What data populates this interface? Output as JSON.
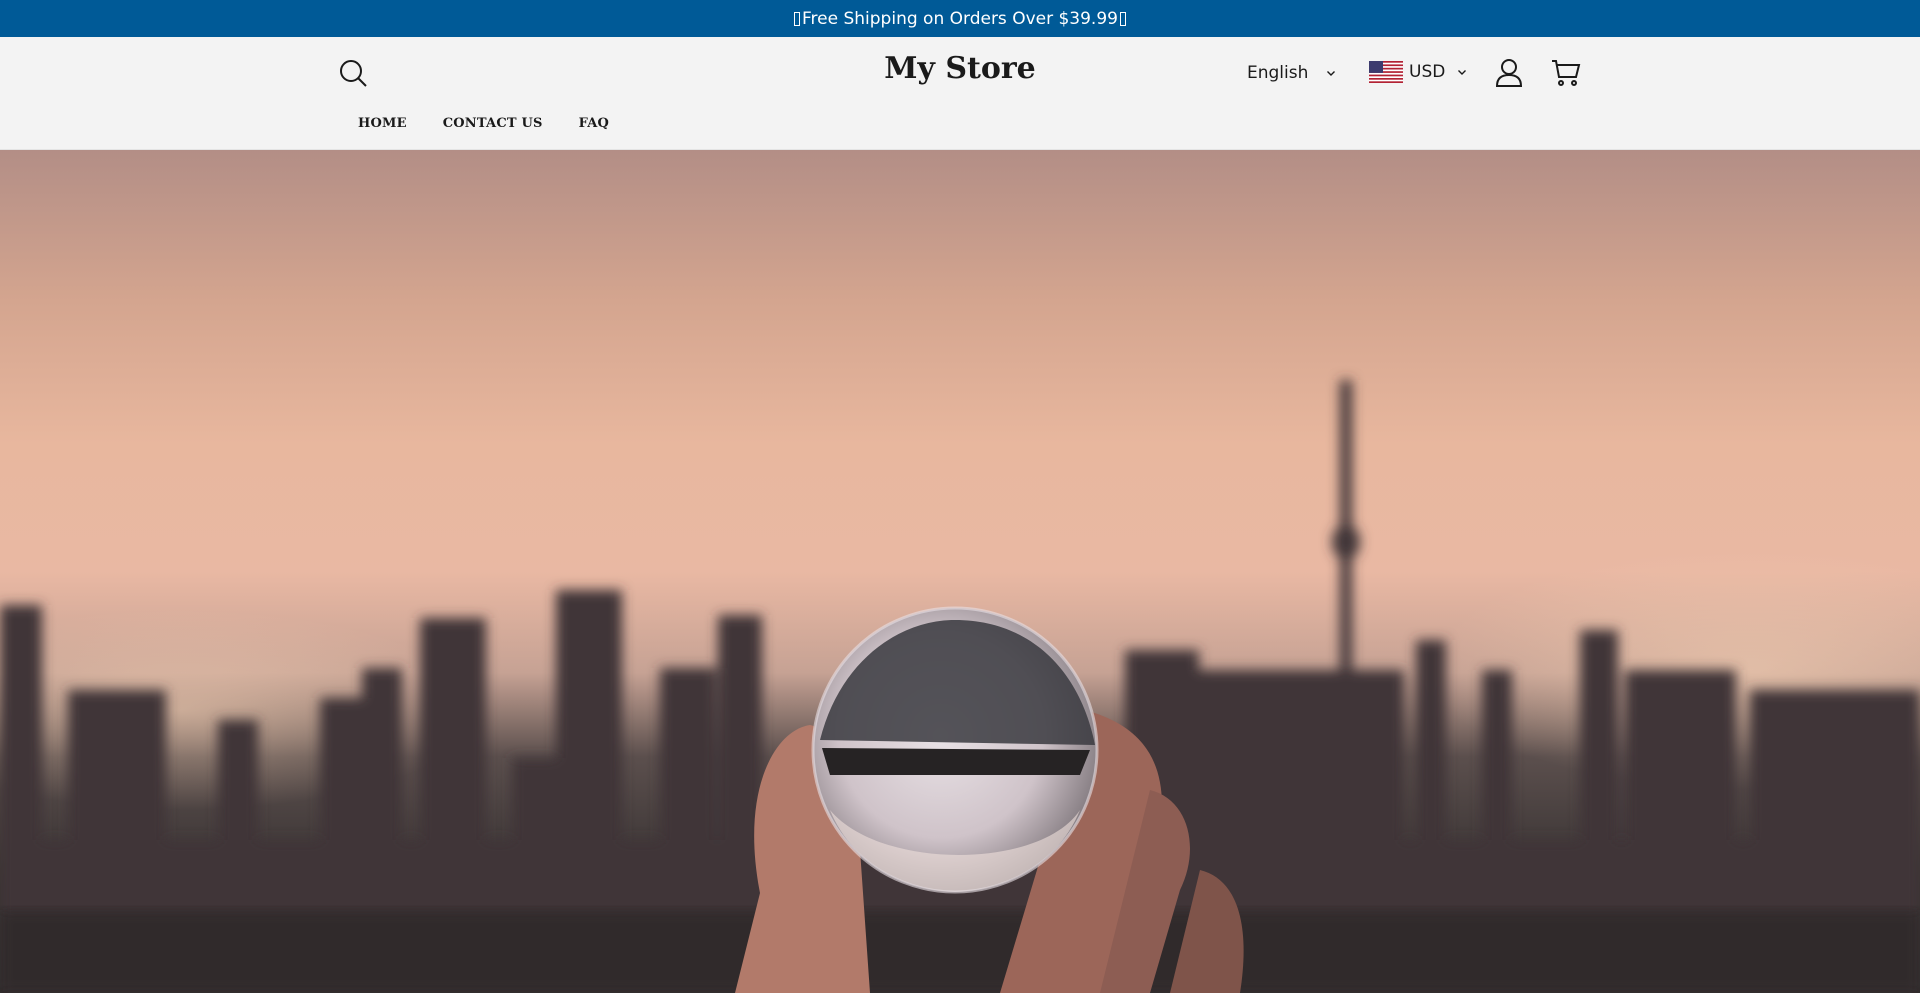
{
  "announcement": {
    "text": "Free Shipping on Orders Over $39.99"
  },
  "header": {
    "logo": "My Store",
    "language": {
      "selected": "English"
    },
    "currency": {
      "selected": "USD"
    }
  },
  "nav": {
    "items": [
      "HOME",
      "CONTACT US",
      "FAQ"
    ]
  },
  "colors": {
    "announcement_bg": "#005a97",
    "header_bg": "#f3f3f3",
    "text": "#1a1a1a"
  },
  "icons": {
    "search": "search-icon",
    "account": "user-icon",
    "cart": "cart-icon",
    "chevron": "chevron-down-icon",
    "flag": "us-flag-icon"
  }
}
